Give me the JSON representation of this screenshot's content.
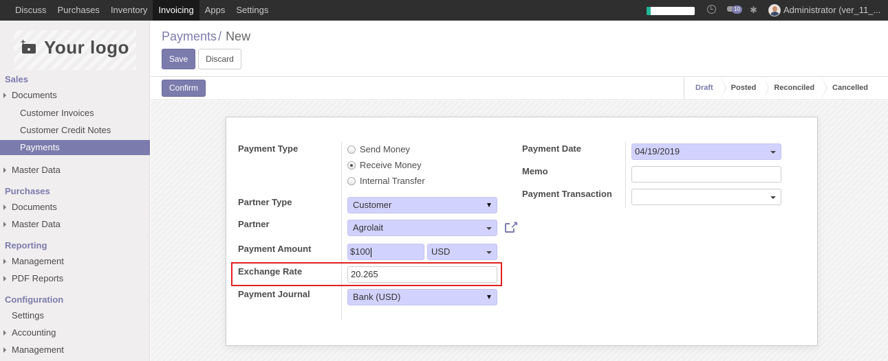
{
  "topbar": {
    "menu": [
      "Discuss",
      "Purchases",
      "Inventory",
      "Invoicing",
      "Apps",
      "Settings"
    ],
    "active_menu": "Invoicing",
    "progress_fraction": 0.08,
    "progress_color": "#21b799",
    "icons": [
      "clock-icon",
      "chat-icon",
      "bug-icon",
      "avatar"
    ],
    "chat_badge": "10",
    "user": "Administrator (ver_11_..."
  },
  "sidebar": {
    "logo_text": "Your logo",
    "sections": [
      {
        "title": "Sales",
        "items": [
          {
            "label": "Documents",
            "type": "group"
          },
          {
            "label": "Customer Invoices",
            "type": "sub"
          },
          {
            "label": "Customer Credit Notes",
            "type": "sub"
          },
          {
            "label": "Payments",
            "type": "sub",
            "active": true
          },
          {
            "label": "Master Data",
            "type": "group"
          }
        ]
      },
      {
        "title": "Purchases",
        "items": [
          {
            "label": "Documents",
            "type": "group"
          },
          {
            "label": "Master Data",
            "type": "group"
          }
        ]
      },
      {
        "title": "Reporting",
        "items": [
          {
            "label": "Management",
            "type": "group"
          },
          {
            "label": "PDF Reports",
            "type": "group"
          }
        ]
      },
      {
        "title": "Configuration",
        "items": [
          {
            "label": "Settings",
            "type": "leaf"
          },
          {
            "label": "Accounting",
            "type": "group"
          },
          {
            "label": "Management",
            "type": "group"
          }
        ]
      }
    ]
  },
  "breadcrumb": {
    "parent": "Payments",
    "separator": "/",
    "current": "New"
  },
  "buttons": {
    "save": "Save",
    "discard": "Discard",
    "confirm": "Confirm"
  },
  "statusbar": {
    "stages": [
      "Draft",
      "Posted",
      "Reconciled",
      "Cancelled"
    ],
    "current": "Draft"
  },
  "form": {
    "payment_type": {
      "label": "Payment Type",
      "options": [
        "Send Money",
        "Receive Money",
        "Internal Transfer"
      ],
      "selected": "Receive Money"
    },
    "partner_type": {
      "label": "Partner Type",
      "value": "Customer"
    },
    "partner": {
      "label": "Partner",
      "value": "Agrolait"
    },
    "payment_amount": {
      "label": "Payment Amount",
      "amount": "$100",
      "currency": "USD"
    },
    "exchange_rate": {
      "label": "Exchange Rate",
      "value": "20.265"
    },
    "payment_journal": {
      "label": "Payment Journal",
      "value": "Bank (USD)"
    },
    "payment_date": {
      "label": "Payment Date",
      "value": "04/19/2019"
    },
    "memo": {
      "label": "Memo",
      "value": ""
    },
    "payment_transaction": {
      "label": "Payment Transaction",
      "value": ""
    }
  },
  "colors": {
    "accent": "#7c7bad",
    "required_field_bg": "#d2d2ff",
    "highlight_border": "#e02020",
    "topbar_bg": "#2f2f2f"
  }
}
